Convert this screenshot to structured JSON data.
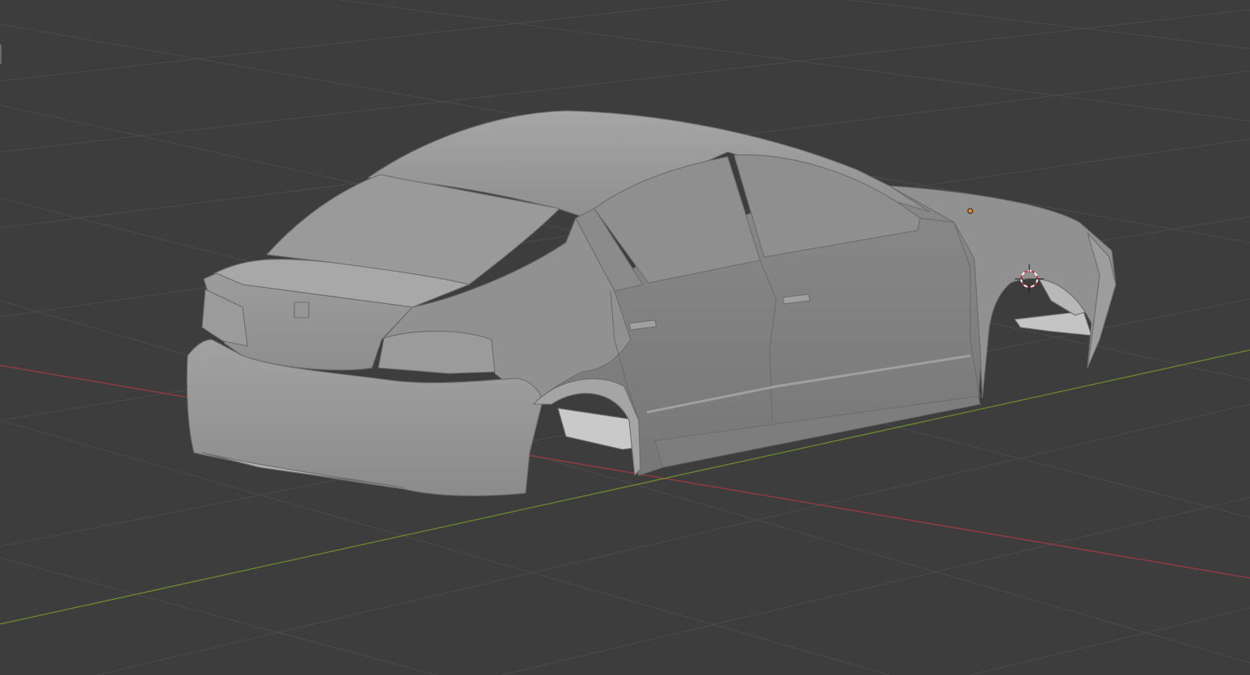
{
  "viewport": {
    "mode": "3d-viewport",
    "shading": "solid",
    "background_color": "#3d3d3d",
    "grid_color": "#4b4b4b",
    "x_axis_color": "#9b3a44",
    "y_axis_color": "#6c8a2b"
  },
  "scene": {
    "object": "car-body-mesh",
    "object_color": "#9a9a9a",
    "origin_color": "#f08c1e",
    "cursor_colors": [
      "#ffffff",
      "#d0303a"
    ]
  }
}
